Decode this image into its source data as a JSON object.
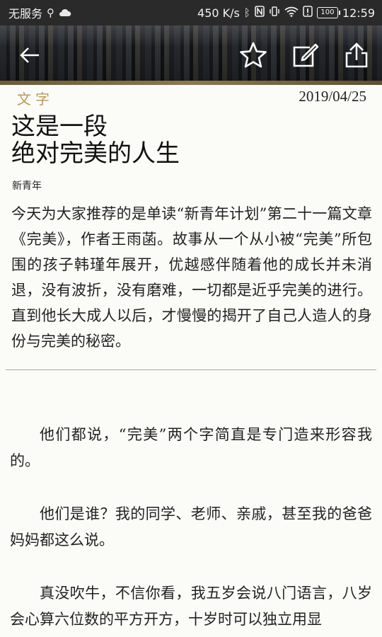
{
  "status_bar": {
    "carrier": "无服务",
    "speed": "450 K/s",
    "battery": "100",
    "time": "12:59"
  },
  "header": {
    "icons": [
      "back-arrow-icon",
      "star-icon",
      "edit-icon",
      "share-icon"
    ]
  },
  "article": {
    "category": "文字",
    "date": "2019/04/25",
    "title_line1": "这是一段",
    "title_line2": "绝对完美的人生",
    "source": "新青年",
    "summary": "今天为大家推荐的是单读“新青年计划”第二十一篇文章《完美》，作者王雨菡。故事从一个从小被“完美”所包围的孩子韩瑾年展开，优越感伴随着他的成长并未消退，没有波折，没有磨难，一切都是近乎完美的进行。直到他长大成人以后，才慢慢的揭开了自己人造人的身份与完美的秘密。",
    "paragraphs": [
      "他们都说，“完美”两个字简直是专门造来形容我的。",
      "他们是谁？我的同学、老师、亲戚，甚至我的爸爸妈妈都这么说。",
      "真没吹牛，不信你看，我五岁会说八门语言，八岁会心算六位数的平方开方，十岁时可以独立用显"
    ]
  },
  "colors": {
    "accent_gold": "#b99a58",
    "status_bar_bg": "#2a2a2a",
    "page_bg": "#fbfbf8"
  }
}
